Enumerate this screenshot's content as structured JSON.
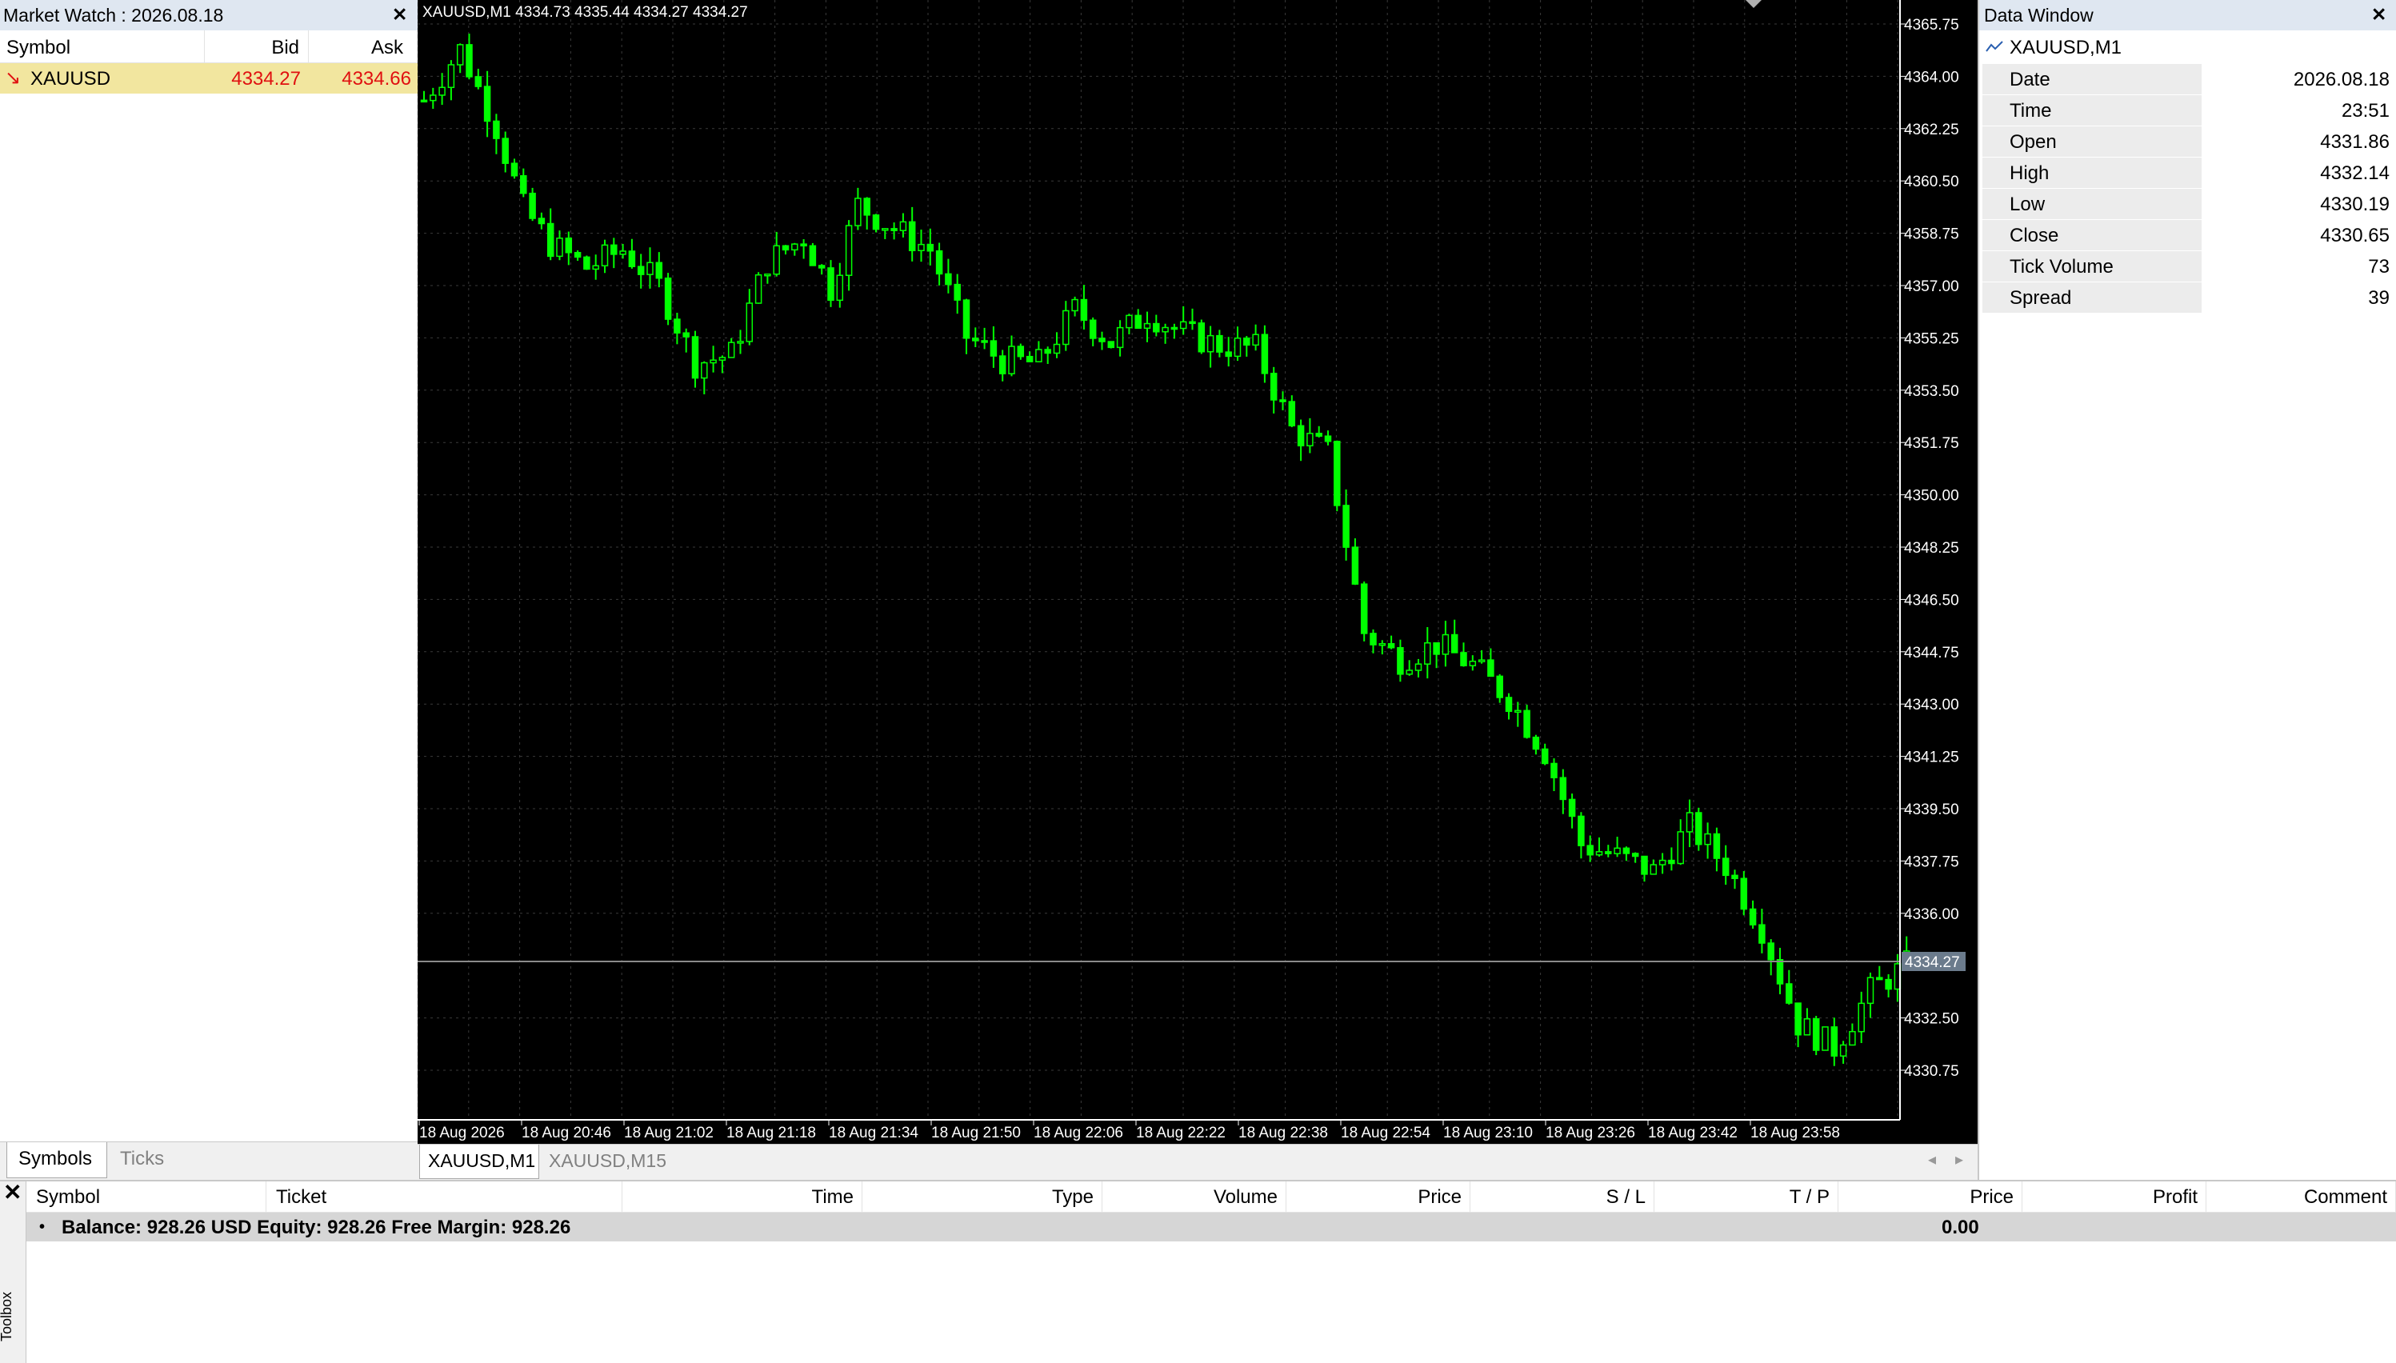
{
  "market_watch": {
    "title": "Market Watch : 2026.08.18",
    "headers": {
      "symbol": "Symbol",
      "bid": "Bid",
      "ask": "Ask"
    },
    "row": {
      "arrow": "↘",
      "symbol": "XAUUSD",
      "bid": "4334.27",
      "ask": "4334.66"
    },
    "tabs": {
      "symbols": "Symbols",
      "ticks": "Ticks"
    }
  },
  "chart": {
    "header": "XAUUSD,M1  4334.73 4335.44 4334.27 4334.27",
    "price_labels": [
      "4365.75",
      "4364.00",
      "4362.25",
      "4360.50",
      "4358.75",
      "4357.00",
      "4355.25",
      "4353.50",
      "4351.75",
      "4350.00",
      "4348.25",
      "4346.50",
      "4344.75",
      "4343.00",
      "4341.25",
      "4339.50",
      "4337.75",
      "4336.00",
      "4332.50",
      "4330.75"
    ],
    "current_price": "4334.27",
    "time_labels": [
      "18 Aug 2026",
      "18 Aug 20:46",
      "18 Aug 21:02",
      "18 Aug 21:18",
      "18 Aug 21:34",
      "18 Aug 21:50",
      "18 Aug 22:06",
      "18 Aug 22:22",
      "18 Aug 22:38",
      "18 Aug 22:54",
      "18 Aug 23:10",
      "18 Aug 23:26",
      "18 Aug 23:42",
      "18 Aug 23:58"
    ],
    "tabs": {
      "active": "XAUUSD,M1",
      "inactive": "XAUUSD,M15"
    },
    "colors": {
      "background": "#000000",
      "bull": "#00ff00",
      "grid": "#3a3a3a",
      "axis_text": "#ffffff"
    }
  },
  "chart_data": {
    "type": "candlestick",
    "symbol": "XAUUSD",
    "timeframe": "M1",
    "ylim": [
      4329.9,
      4366.5
    ],
    "close_path": [
      [
        0,
        4363.2
      ],
      [
        4,
        4364.9
      ],
      [
        8,
        4362.3
      ],
      [
        11,
        4359.6
      ],
      [
        14,
        4358.4
      ],
      [
        18,
        4357.6
      ],
      [
        22,
        4358.2
      ],
      [
        26,
        4357.0
      ],
      [
        30,
        4354.4
      ],
      [
        34,
        4354.7
      ],
      [
        38,
        4357.8
      ],
      [
        42,
        4358.6
      ],
      [
        45,
        4356.9
      ],
      [
        48,
        4359.7
      ],
      [
        52,
        4358.9
      ],
      [
        56,
        4358.2
      ],
      [
        60,
        4355.3
      ],
      [
        64,
        4354.5
      ],
      [
        68,
        4354.4
      ],
      [
        72,
        4356.2
      ],
      [
        76,
        4355.1
      ],
      [
        80,
        4356.1
      ],
      [
        84,
        4355.4
      ],
      [
        88,
        4355.0
      ],
      [
        92,
        4354.9
      ],
      [
        96,
        4352.2
      ],
      [
        100,
        4351.4
      ],
      [
        104,
        4345.4
      ],
      [
        108,
        4344.5
      ],
      [
        112,
        4345.0
      ],
      [
        116,
        4344.3
      ],
      [
        120,
        4343.2
      ],
      [
        124,
        4341.4
      ],
      [
        128,
        4338.3
      ],
      [
        132,
        4337.9
      ],
      [
        136,
        4337.4
      ],
      [
        140,
        4338.9
      ],
      [
        144,
        4337.6
      ],
      [
        148,
        4335.5
      ],
      [
        152,
        4332.3
      ],
      [
        156,
        4331.5
      ],
      [
        160,
        4333.4
      ],
      [
        164,
        4334.27
      ]
    ]
  },
  "data_window": {
    "title": "Data Window",
    "symbol": "XAUUSD,M1",
    "rows": [
      {
        "label": "Date",
        "value": "2026.08.18"
      },
      {
        "label": "Time",
        "value": "23:51"
      },
      {
        "label": "Open",
        "value": "4331.86"
      },
      {
        "label": "High",
        "value": "4332.14"
      },
      {
        "label": "Low",
        "value": "4330.19"
      },
      {
        "label": "Close",
        "value": "4330.65"
      },
      {
        "label": "Tick Volume",
        "value": "73"
      },
      {
        "label": "Spread",
        "value": "39"
      }
    ]
  },
  "toolbox": {
    "label": "Toolbox",
    "headers": [
      "Symbol",
      "Ticket",
      "Time",
      "Type",
      "Volume",
      "Price",
      "S / L",
      "T / P",
      "Price",
      "Profit",
      "Comment"
    ],
    "balance_line": "Balance: 928.26 USD  Equity: 928.26  Free Margin: 928.26",
    "profit": "0.00"
  }
}
